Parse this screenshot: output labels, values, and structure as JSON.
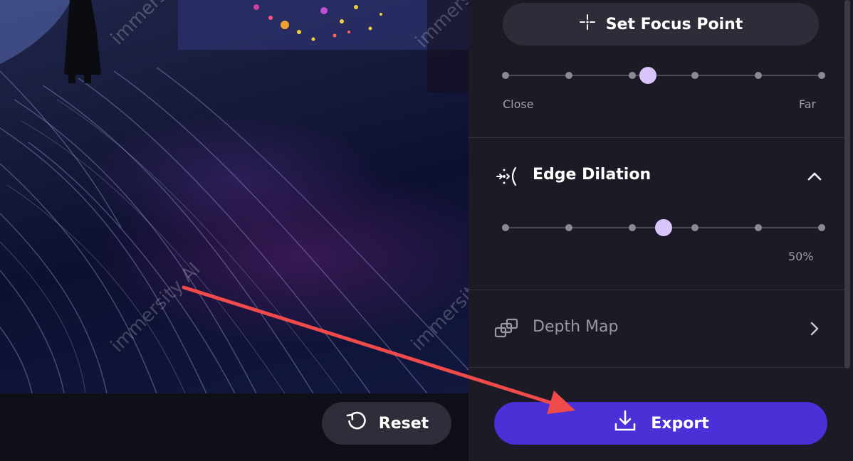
{
  "focus": {
    "set_focus_label": "Set Focus Point",
    "min_label": "Close",
    "max_label": "Far",
    "steps": 5,
    "value_step": 2.25
  },
  "edge_dilation": {
    "title": "Edge Dilation",
    "value_text": "50%",
    "steps": 5,
    "value_step": 2.5
  },
  "depth_map": {
    "title": "Depth Map"
  },
  "actions": {
    "reset_label": "Reset",
    "export_label": "Export"
  },
  "watermark": {
    "text": "immersity AI"
  },
  "colors": {
    "accent": "#4a30d6",
    "thumb": "#d6c4fb",
    "annotation_arrow": "#f04a4a"
  }
}
